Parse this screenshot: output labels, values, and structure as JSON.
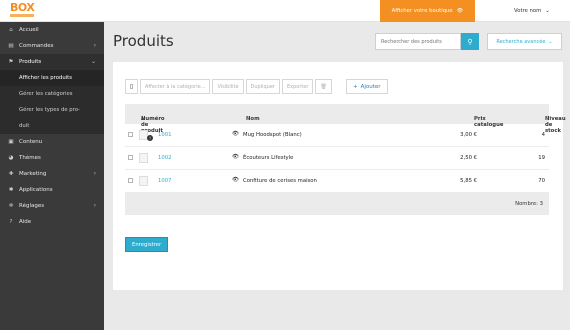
{
  "topbar": {
    "logo_text": "BOX",
    "shop_button": "Afficher votre boutique",
    "user_menu": "Votre nom",
    "accent": "#f39021"
  },
  "sidebar": {
    "items": [
      {
        "label": "Accueil",
        "icon": "home-icon",
        "glyph": "⌂"
      },
      {
        "label": "Commandes",
        "icon": "orders-icon",
        "glyph": "▤",
        "chevron": "›"
      },
      {
        "label": "Produits",
        "icon": "products-icon",
        "glyph": "⚑",
        "chevron": "⌄"
      },
      {
        "label": "Contenu",
        "icon": "content-icon",
        "glyph": "▣"
      },
      {
        "label": "Thèmes",
        "icon": "themes-icon",
        "glyph": "◕"
      },
      {
        "label": "Marketing",
        "icon": "marketing-icon",
        "glyph": "✚",
        "chevron": "›"
      },
      {
        "label": "Applications",
        "icon": "applications-icon",
        "glyph": "✱"
      },
      {
        "label": "Réglages",
        "icon": "settings-icon",
        "glyph": "✲",
        "chevron": "›"
      },
      {
        "label": "Aide",
        "icon": "help-icon",
        "glyph": "?"
      }
    ],
    "submenu": [
      {
        "label": "Afficher les produits"
      },
      {
        "label": "Gérer les catégories"
      },
      {
        "label": "Gérer les types de pro-"
      },
      {
        "label": "duit"
      }
    ]
  },
  "header": {
    "title": "Produits",
    "search_placeholder": "Rechercher des produits",
    "advanced_search": "Recherche avancée"
  },
  "toolbar": {
    "assign_category": "Affecter à la catégorie...",
    "visibility": "Visibilité",
    "duplicate": "Dupliquer",
    "export": "Exporter",
    "delete": "🗑",
    "add": "Ajouter"
  },
  "table": {
    "columns": {
      "id": "Numéro de produit",
      "name": "Nom",
      "price": "Prix catalogue",
      "stock": "Niveau de stock"
    },
    "rows": [
      {
        "id": "1001",
        "name": "Mug Hoodspot (Blanc)",
        "price": "3,00 €",
        "stock": "4"
      },
      {
        "id": "1002",
        "name": "Écouteurs Lifestyle",
        "price": "2,50 €",
        "stock": "19"
      },
      {
        "id": "1007",
        "name": "Confiture de cerises maison",
        "price": "5,85 €",
        "stock": "70"
      }
    ],
    "footer": "Nombre: 3"
  },
  "actions": {
    "save": "Enregistrer"
  }
}
